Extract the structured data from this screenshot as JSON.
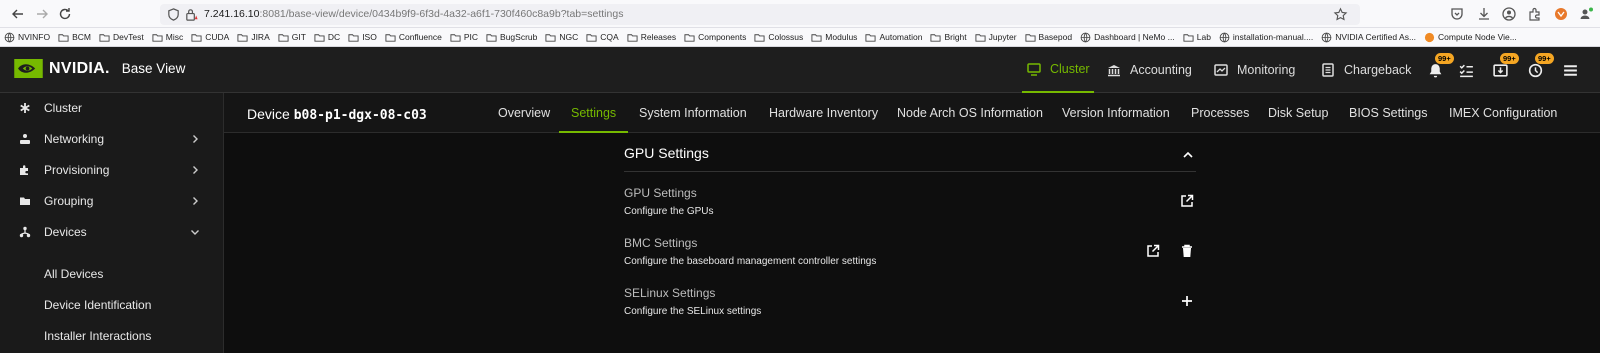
{
  "browser": {
    "url_host": "7.241.16.10",
    "url_rest": ":8081/base-view/device/0434b9f9-6f3d-4a32-a6f1-730f460c8a9b?tab=settings"
  },
  "bookmarks": [
    "NVINFO",
    "BCM",
    "DevTest",
    "Misc",
    "CUDA",
    "JIRA",
    "GIT",
    "DC",
    "ISO",
    "Confluence",
    "PIC",
    "BugScrub",
    "NGC",
    "CQA",
    "Releases",
    "Components",
    "Colossus",
    "Modulus",
    "Automation",
    "Bright",
    "Jupyter",
    "Basepod",
    "Dashboard | NeMo ...",
    "Lab",
    "installation-manual....",
    "NVIDIA Certified As...",
    "Compute Node Vie..."
  ],
  "header": {
    "brand": "NVIDIA.",
    "product": "Base View",
    "nav": [
      "Cluster",
      "Accounting",
      "Monitoring",
      "Chargeback"
    ],
    "badges": [
      "99+",
      "99+",
      "99+"
    ]
  },
  "sidebar": {
    "items": [
      {
        "label": "Cluster",
        "icon": "asterisk-icon"
      },
      {
        "label": "Networking",
        "icon": "network-icon"
      },
      {
        "label": "Provisioning",
        "icon": "puzzle-icon"
      },
      {
        "label": "Grouping",
        "icon": "folder-icon"
      },
      {
        "label": "Devices",
        "icon": "devices-icon"
      }
    ],
    "subitems": [
      "All Devices",
      "Device Identification",
      "Installer Interactions"
    ]
  },
  "device": {
    "prefix": "Device",
    "name": "b08-p1-dgx-08-c03",
    "tabs": [
      "Overview",
      "Settings",
      "System Information",
      "Hardware Inventory",
      "Node Arch OS Information",
      "Version Information",
      "Processes",
      "Disk Setup",
      "BIOS Settings",
      "IMEX Configuration"
    ],
    "active_tab": "Settings"
  },
  "section": {
    "title": "GPU Settings",
    "rows": [
      {
        "title": "GPU Settings",
        "desc": "Configure the GPUs"
      },
      {
        "title": "BMC Settings",
        "desc": "Configure the baseboard management controller settings"
      },
      {
        "title": "SELinux Settings",
        "desc": "Configure the SELinux settings"
      }
    ]
  },
  "colors": {
    "accent": "#76b900",
    "badge": "#f5a623"
  }
}
